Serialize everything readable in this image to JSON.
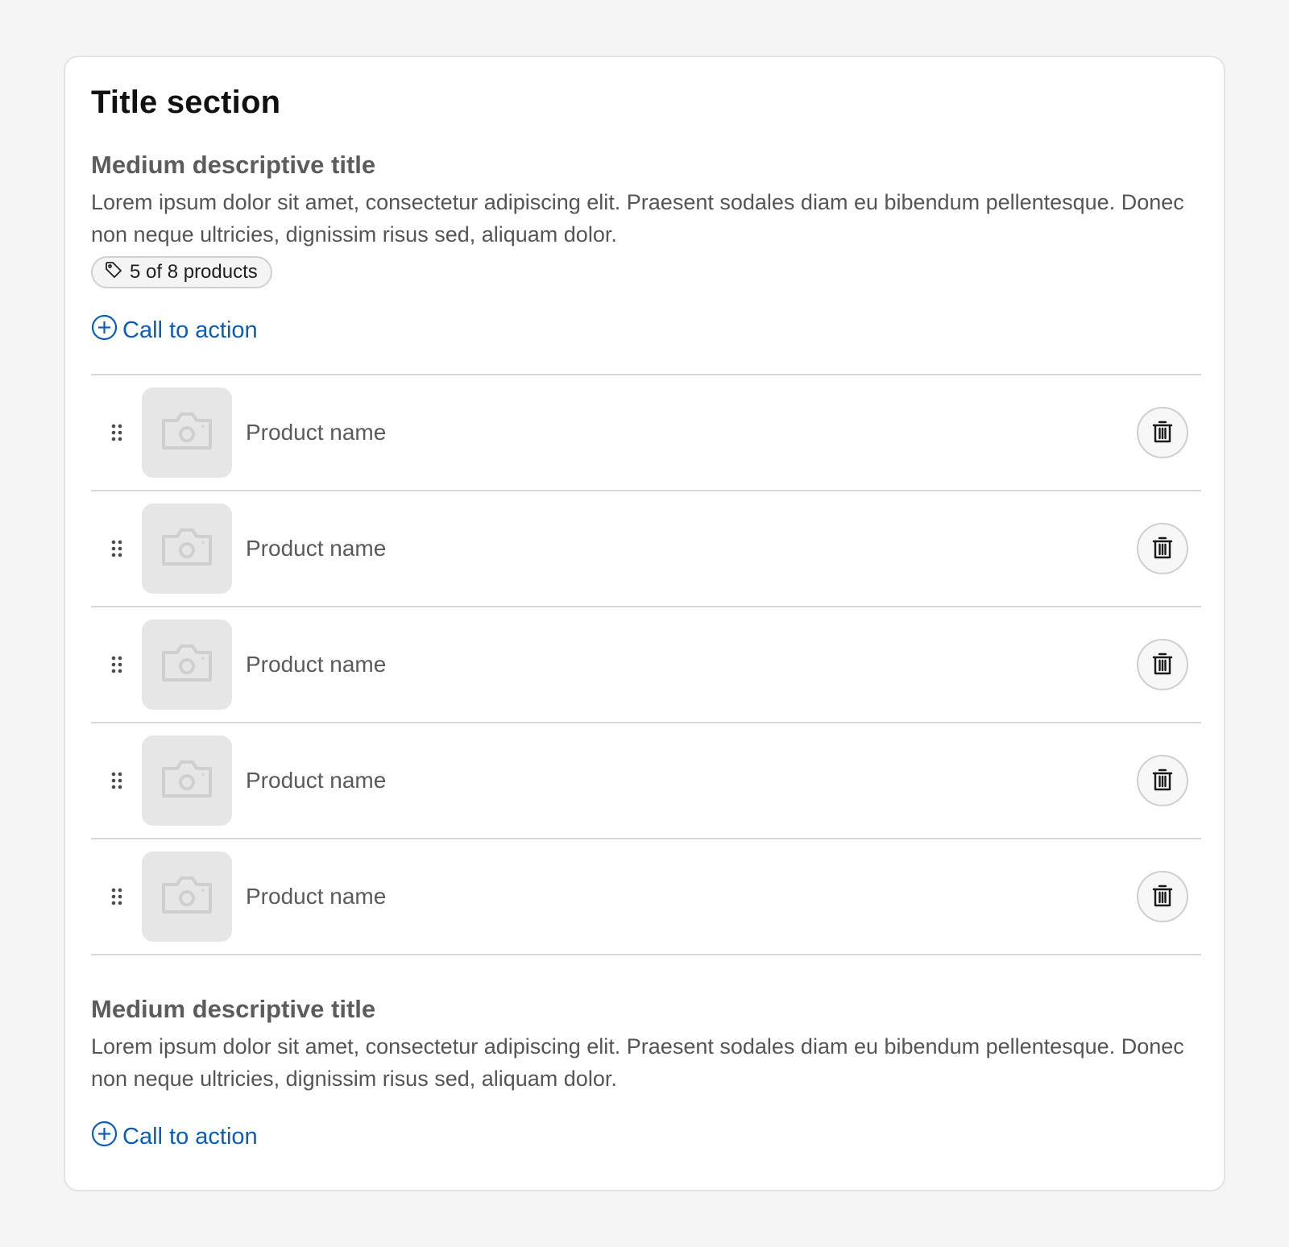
{
  "card": {
    "title": "Title section"
  },
  "section_top": {
    "subtitle": "Medium descriptive title",
    "description": "Lorem ipsum dolor sit amet, consectetur adipiscing elit. Praesent sodales diam eu bibendum pellentesque. Donec non neque ultricies, dignissim risus sed, aliquam dolor.",
    "badge": {
      "icon": "tag-icon",
      "label": "5 of 8 products"
    },
    "cta": {
      "icon": "plus-circle-icon",
      "label": "Call to action"
    }
  },
  "products": [
    {
      "name": "Product name",
      "image_icon": "camera-icon",
      "delete_icon": "trash-icon"
    },
    {
      "name": "Product name",
      "image_icon": "camera-icon",
      "delete_icon": "trash-icon"
    },
    {
      "name": "Product name",
      "image_icon": "camera-icon",
      "delete_icon": "trash-icon"
    },
    {
      "name": "Product name",
      "image_icon": "camera-icon",
      "delete_icon": "trash-icon"
    },
    {
      "name": "Product name",
      "image_icon": "camera-icon",
      "delete_icon": "trash-icon"
    }
  ],
  "section_bottom": {
    "subtitle": "Medium descriptive title",
    "description": "Lorem ipsum dolor sit amet, consectetur adipiscing elit. Praesent sodales diam eu bibendum pellentesque. Donec non neque ultricies, dignissim risus sed, aliquam dolor.",
    "cta": {
      "icon": "plus-circle-icon",
      "label": "Call to action"
    }
  },
  "colors": {
    "page_background": "#f5f5f5",
    "card_background": "#ffffff",
    "link": "#0a5eb8",
    "thumbnail_placeholder": "#e6e6e6"
  }
}
